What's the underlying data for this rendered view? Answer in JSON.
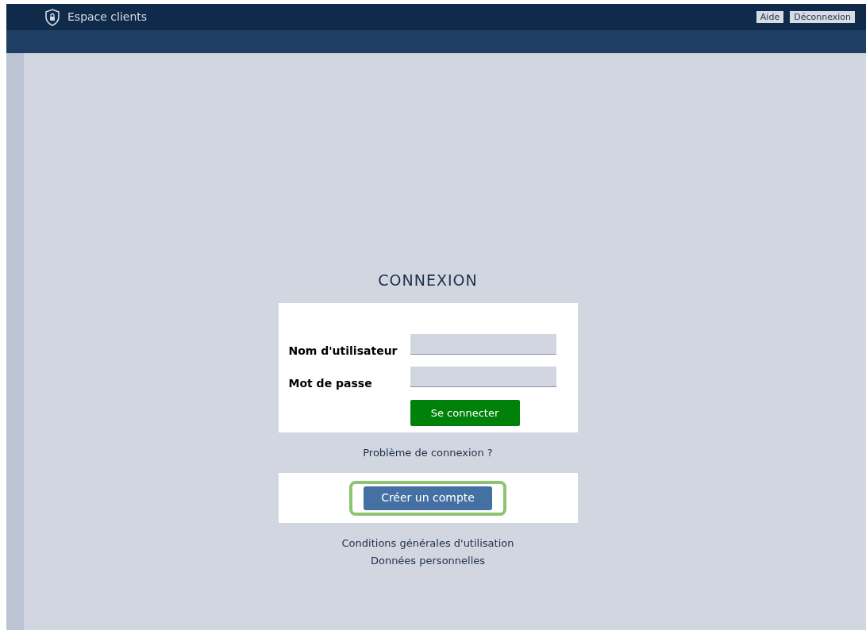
{
  "header": {
    "title": "Espace clients",
    "buttons": [
      "Aide",
      "Déconnexion"
    ]
  },
  "login": {
    "title": "CONNEXION",
    "fields": [
      {
        "label": "Nom d'utilisateur"
      },
      {
        "label": "Mot de passe"
      }
    ],
    "submit": "Se connecter",
    "help_link": "Problème de connexion ?",
    "create_account": {
      "label": "Créer un compte",
      "highlighted": true
    },
    "footer_links": [
      "Conditions générales d'utilisation",
      "Données personnelles"
    ]
  }
}
